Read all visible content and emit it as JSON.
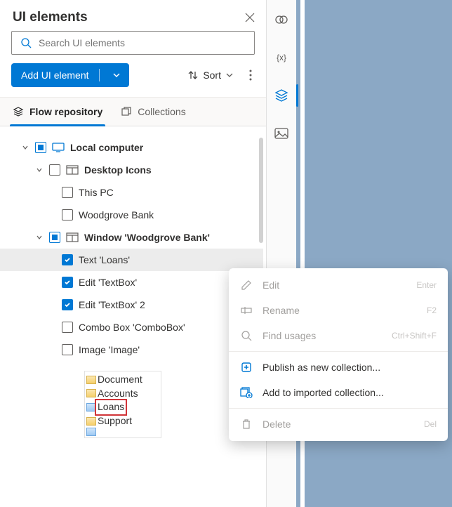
{
  "header": {
    "title": "UI elements"
  },
  "search": {
    "placeholder": "Search UI elements"
  },
  "toolbar": {
    "add_label": "Add UI element",
    "sort_label": "Sort"
  },
  "tabs": {
    "flow": "Flow repository",
    "collections": "Collections"
  },
  "tree": {
    "root": "Local computer",
    "desktop": "Desktop Icons",
    "this_pc": "This PC",
    "woodgrove": "Woodgrove Bank",
    "window": "Window 'Woodgrove Bank'",
    "text_loans": "Text 'Loans'",
    "edit_tb": "Edit 'TextBox'",
    "edit_tb2": "Edit 'TextBox' 2",
    "combo": "Combo Box 'ComboBox'",
    "image": "Image 'Image'"
  },
  "context_menu": {
    "edit": "Edit",
    "edit_accel": "Enter",
    "rename": "Rename",
    "rename_accel": "F2",
    "find": "Find usages",
    "find_accel": "Ctrl+Shift+F",
    "publish": "Publish as new collection...",
    "add_to": "Add to imported collection...",
    "delete": "Delete",
    "delete_accel": "Del"
  },
  "preview": {
    "lines": [
      "Document",
      "Accounts",
      "Loans",
      "Support"
    ]
  }
}
